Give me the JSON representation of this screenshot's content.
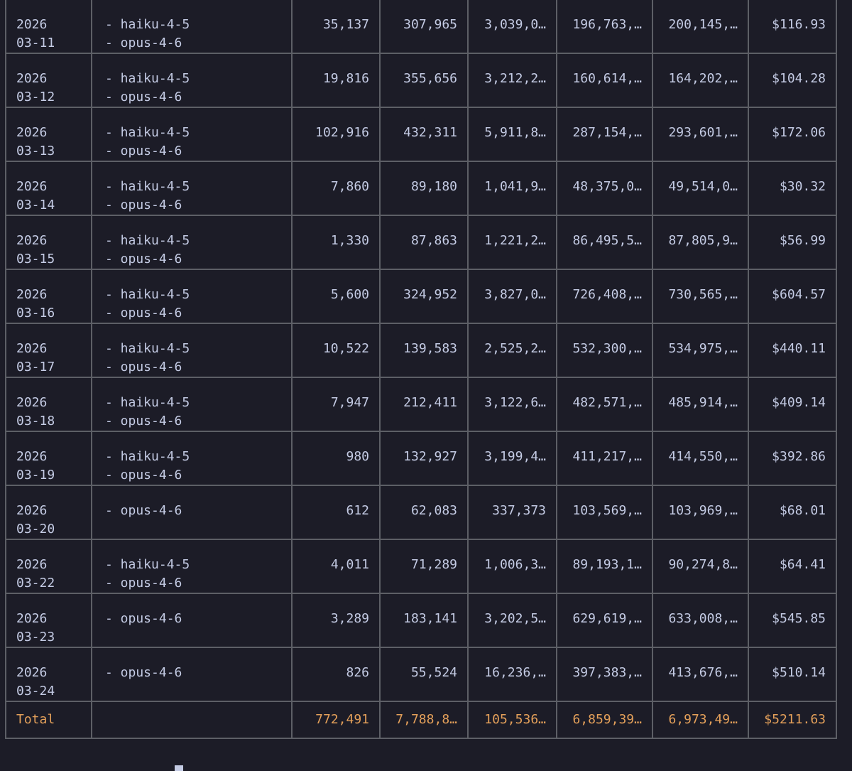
{
  "rows": [
    {
      "date_y": "2026",
      "date_md": "03-11",
      "models": [
        "- haiku-4-5",
        "- opus-4-6"
      ],
      "c1": "35,137",
      "c2": "307,965",
      "c3": "3,039,0…",
      "c4": "196,763,…",
      "c5": "200,145,…",
      "cost": "$116.93"
    },
    {
      "date_y": "2026",
      "date_md": "03-12",
      "models": [
        "- haiku-4-5",
        "- opus-4-6"
      ],
      "c1": "19,816",
      "c2": "355,656",
      "c3": "3,212,2…",
      "c4": "160,614,…",
      "c5": "164,202,…",
      "cost": "$104.28"
    },
    {
      "date_y": "2026",
      "date_md": "03-13",
      "models": [
        "- haiku-4-5",
        "- opus-4-6"
      ],
      "c1": "102,916",
      "c2": "432,311",
      "c3": "5,911,8…",
      "c4": "287,154,…",
      "c5": "293,601,…",
      "cost": "$172.06"
    },
    {
      "date_y": "2026",
      "date_md": "03-14",
      "models": [
        "- haiku-4-5",
        "- opus-4-6"
      ],
      "c1": "7,860",
      "c2": "89,180",
      "c3": "1,041,9…",
      "c4": "48,375,0…",
      "c5": "49,514,0…",
      "cost": "$30.32"
    },
    {
      "date_y": "2026",
      "date_md": "03-15",
      "models": [
        "- haiku-4-5",
        "- opus-4-6"
      ],
      "c1": "1,330",
      "c2": "87,863",
      "c3": "1,221,2…",
      "c4": "86,495,5…",
      "c5": "87,805,9…",
      "cost": "$56.99"
    },
    {
      "date_y": "2026",
      "date_md": "03-16",
      "models": [
        "- haiku-4-5",
        "- opus-4-6"
      ],
      "c1": "5,600",
      "c2": "324,952",
      "c3": "3,827,0…",
      "c4": "726,408,…",
      "c5": "730,565,…",
      "cost": "$604.57"
    },
    {
      "date_y": "2026",
      "date_md": "03-17",
      "models": [
        "- haiku-4-5",
        "- opus-4-6"
      ],
      "c1": "10,522",
      "c2": "139,583",
      "c3": "2,525,2…",
      "c4": "532,300,…",
      "c5": "534,975,…",
      "cost": "$440.11"
    },
    {
      "date_y": "2026",
      "date_md": "03-18",
      "models": [
        "- haiku-4-5",
        "- opus-4-6"
      ],
      "c1": "7,947",
      "c2": "212,411",
      "c3": "3,122,6…",
      "c4": "482,571,…",
      "c5": "485,914,…",
      "cost": "$409.14"
    },
    {
      "date_y": "2026",
      "date_md": "03-19",
      "models": [
        "- haiku-4-5",
        "- opus-4-6"
      ],
      "c1": "980",
      "c2": "132,927",
      "c3": "3,199,4…",
      "c4": "411,217,…",
      "c5": "414,550,…",
      "cost": "$392.86"
    },
    {
      "date_y": "2026",
      "date_md": "03-20",
      "models": [
        "- opus-4-6"
      ],
      "c1": "612",
      "c2": "62,083",
      "c3": "337,373",
      "c4": "103,569,…",
      "c5": "103,969,…",
      "cost": "$68.01"
    },
    {
      "date_y": "2026",
      "date_md": "03-22",
      "models": [
        "- haiku-4-5",
        "- opus-4-6"
      ],
      "c1": "4,011",
      "c2": "71,289",
      "c3": "1,006,3…",
      "c4": "89,193,1…",
      "c5": "90,274,8…",
      "cost": "$64.41"
    },
    {
      "date_y": "2026",
      "date_md": "03-23",
      "models": [
        "- opus-4-6"
      ],
      "c1": "3,289",
      "c2": "183,141",
      "c3": "3,202,5…",
      "c4": "629,619,…",
      "c5": "633,008,…",
      "cost": "$545.85"
    },
    {
      "date_y": "2026",
      "date_md": "03-24",
      "models": [
        "- opus-4-6"
      ],
      "c1": "826",
      "c2": "55,524",
      "c3": "16,236,…",
      "c4": "397,383,…",
      "c5": "413,676,…",
      "cost": "$510.14"
    }
  ],
  "total": {
    "label": "Total",
    "models": "",
    "c1": "772,491",
    "c2": "7,788,8…",
    "c3": "105,536…",
    "c4": "6,859,39…",
    "c5": "6,973,49…",
    "cost": "$5211.63"
  },
  "colors": {
    "background": "#1c1c27",
    "text": "#c4cbe4",
    "total": "#e4a05a",
    "border": "#5d5f66"
  }
}
